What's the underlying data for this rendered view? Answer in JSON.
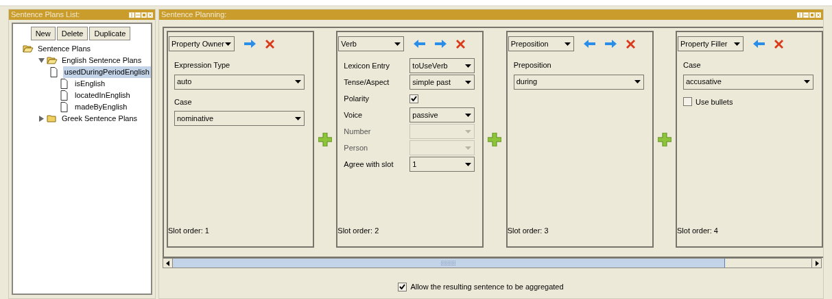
{
  "plans_panel": {
    "title": "Sentence Plans List:",
    "buttons": [
      "New",
      "Delete",
      "Duplicate"
    ],
    "tree": [
      {
        "label": "Sentence Plans",
        "kind": "folder",
        "expanded": true,
        "selected": false,
        "children": [
          {
            "label": "English Sentence Plans",
            "kind": "folder",
            "expanded": true,
            "selected": false,
            "children": [
              {
                "label": "usedDuringPeriodEnglish",
                "kind": "file",
                "selected": true
              },
              {
                "label": "isEnglish",
                "kind": "file",
                "selected": false
              },
              {
                "label": "locatedInEnglish",
                "kind": "file",
                "selected": false
              },
              {
                "label": "madeByEnglish",
                "kind": "file",
                "selected": false
              }
            ]
          },
          {
            "label": "Greek Sentence Plans",
            "kind": "folder",
            "expanded": false,
            "selected": false
          }
        ]
      }
    ]
  },
  "planning_panel": {
    "title": "Sentence Planning:",
    "slots": [
      {
        "type": "Property Owner",
        "move_left": false,
        "move_right": true,
        "slot_order": "Slot order: 1",
        "fields": [
          {
            "kind": "stacked_combo",
            "label": "Expression Type",
            "value": "auto"
          },
          {
            "kind": "stacked_combo",
            "label": "Case",
            "value": "nominative"
          }
        ]
      },
      {
        "type": "Verb",
        "move_left": true,
        "move_right": true,
        "slot_order": "Slot order: 2",
        "fields": [
          {
            "kind": "row_combo",
            "label": "Lexicon Entry",
            "value": "toUseVerb",
            "disabled": false
          },
          {
            "kind": "row_combo",
            "label": "Tense/Aspect",
            "value": "simple past",
            "disabled": false
          },
          {
            "kind": "row_check",
            "label": "Polarity",
            "checked": true
          },
          {
            "kind": "row_combo",
            "label": "Voice",
            "value": "passive",
            "disabled": false
          },
          {
            "kind": "row_combo",
            "label": "Number",
            "disabled": true
          },
          {
            "kind": "row_combo",
            "label": "Person",
            "disabled": true
          },
          {
            "kind": "row_combo",
            "label": "Agree with slot",
            "value": "1",
            "disabled": false
          }
        ]
      },
      {
        "type": "Preposition",
        "move_left": true,
        "move_right": true,
        "slot_order": "Slot order: 3",
        "fields": [
          {
            "kind": "stacked_combo",
            "label": "Preposition",
            "value": "during"
          }
        ]
      },
      {
        "type": "Property Filler",
        "move_left": true,
        "move_right": false,
        "slot_order": "Slot order: 4",
        "fields": [
          {
            "kind": "stacked_combo",
            "label": "Case",
            "value": "accusative"
          },
          {
            "kind": "check",
            "label": "Use bullets",
            "checked": false
          }
        ]
      }
    ],
    "aggregate": {
      "label": "Allow the resulting sentence to be aggregated",
      "checked": true
    }
  }
}
